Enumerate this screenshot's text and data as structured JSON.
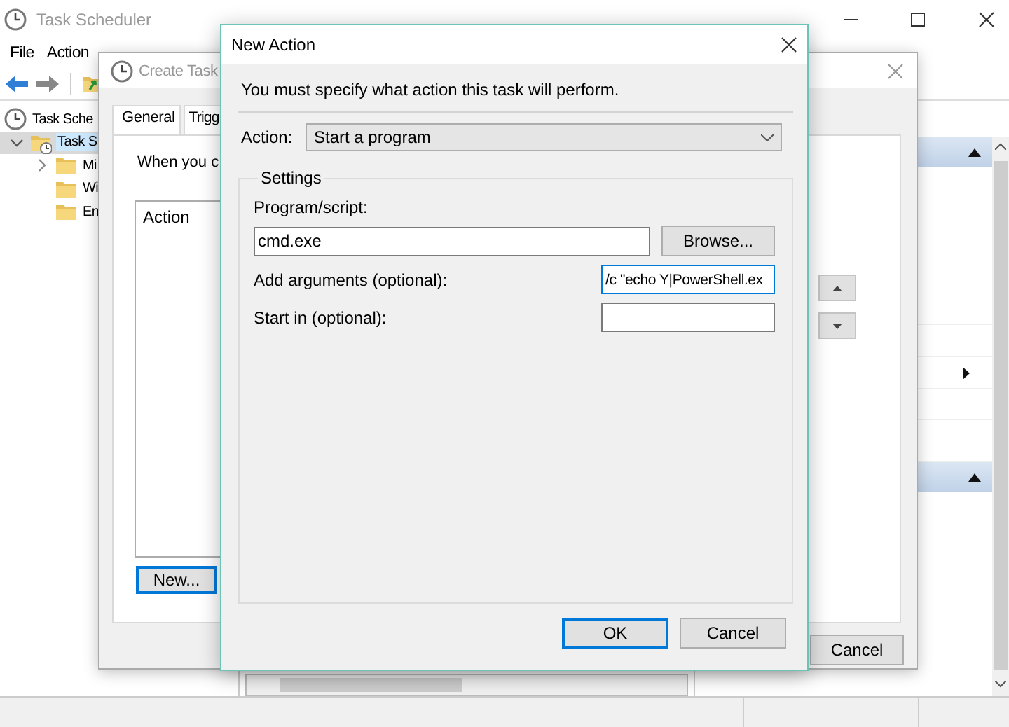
{
  "main_window": {
    "title": "Task Scheduler",
    "menu": [
      {
        "label": "File"
      },
      {
        "label": "Action"
      }
    ],
    "tree": [
      {
        "label": "Task Sche",
        "selected": false,
        "children": [
          {
            "label": "Task S",
            "selected": true,
            "expanded": true,
            "children": [
              {
                "label": "Mi",
                "selected": false,
                "expanded": false
              },
              {
                "label": "Wi",
                "selected": false
              },
              {
                "label": "En",
                "selected": false
              }
            ]
          }
        ]
      }
    ]
  },
  "create_task": {
    "title": "Create Task",
    "tabs": [
      {
        "label": "General",
        "selected": false
      },
      {
        "label": "Trigg",
        "selected": false
      }
    ],
    "hint": "When you c",
    "list_column": "Action",
    "buttons": [
      {
        "label": "New...",
        "focused": true
      },
      {
        "label": "Cancel",
        "focused": false
      }
    ]
  },
  "new_action": {
    "title": "New Action",
    "instruction": "You must specify what action this task will perform.",
    "action": {
      "label": "Action:",
      "value": "Start a program"
    },
    "settings": {
      "title": "Settings",
      "fields": [
        {
          "kind": "stacked",
          "label": "Program/script:",
          "value": "cmd.exe",
          "focused": false,
          "button": "Browse..."
        },
        {
          "kind": "inline",
          "label": "Add arguments (optional):",
          "value": "/c \"echo Y|PowerShell.ex",
          "focused": true
        },
        {
          "kind": "inline",
          "label": "Start in (optional):",
          "focused": false
        }
      ]
    },
    "buttons": [
      {
        "label": "OK",
        "default": true
      },
      {
        "label": "Cancel",
        "default": false
      }
    ]
  }
}
